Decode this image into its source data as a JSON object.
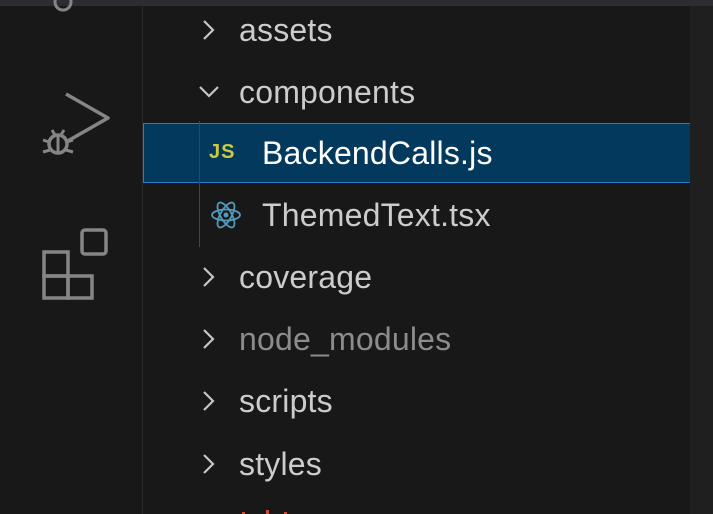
{
  "activity_bar": {
    "icons": [
      "accounts-icon-partial",
      "run-and-debug-icon",
      "extensions-icon"
    ]
  },
  "explorer": {
    "items": [
      {
        "label": "assets",
        "type": "folder",
        "expanded": false
      },
      {
        "label": "components",
        "type": "folder",
        "expanded": true
      },
      {
        "label": "BackendCalls.js",
        "type": "file",
        "icon_badge": "JS",
        "selected": true
      },
      {
        "label": "ThemedText.tsx",
        "type": "file",
        "icon": "react-icon"
      },
      {
        "label": "coverage",
        "type": "folder",
        "expanded": false
      },
      {
        "label": "node_modules",
        "type": "folder",
        "expanded": false,
        "dimmed": true
      },
      {
        "label": "scripts",
        "type": "folder",
        "expanded": false
      },
      {
        "label": "styles",
        "type": "folder",
        "expanded": false
      }
    ]
  },
  "colors": {
    "background": "#181818",
    "selection_bg": "#04395e",
    "selection_border": "#2b79d0",
    "text": "#cccccc",
    "dim_text": "#8c8c8c",
    "js_badge": "#cbcb41",
    "react_icon": "#519aba",
    "cut_off_row_text": "#c74e39"
  }
}
